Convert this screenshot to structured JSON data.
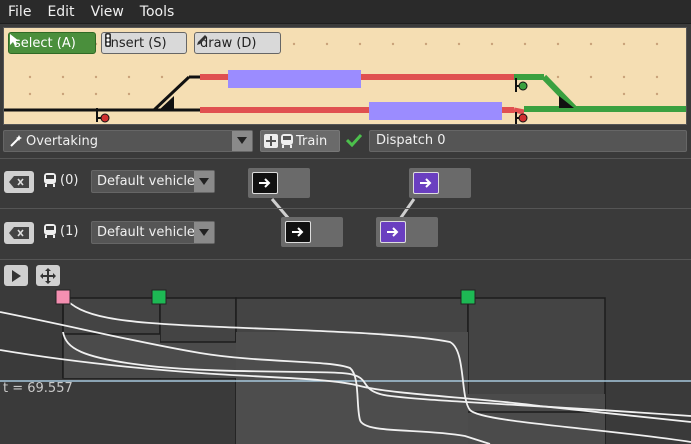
{
  "menubar": {
    "items": [
      "File",
      "Edit",
      "View",
      "Tools"
    ]
  },
  "toolbar": {
    "select_label": "select (A)",
    "insert_label": "insert (S)",
    "draw_label": "draw (D)"
  },
  "scenario": {
    "selected": "Overtaking",
    "add_train_label": "Train",
    "dispatch_label": "Dispatch 0"
  },
  "vehicles": [
    {
      "index_label": "(0)",
      "vehicle": "Default vehicle"
    },
    {
      "index_label": "(1)",
      "vehicle": "Default vehicle"
    }
  ],
  "graph": {
    "time_label": "t = 69.557"
  },
  "colors": {
    "canvas_bg": "#f5deb3",
    "track": "#111111",
    "track_red": "#e05050",
    "track_green": "#3aa040",
    "train": "#9b8cff",
    "active_tool": "#4a8f3c",
    "purple_arrow": "#6a3fc0",
    "graph_line": "#f0f0f0",
    "time_line": "#a6c8dc",
    "marker_pink": "#f48fb1",
    "marker_green": "#1db954"
  },
  "icons": {
    "select": "cursor-arrow-icon",
    "insert": "traffic-light-icon",
    "draw": "pencil-icon",
    "scenario": "magic-wand-icon",
    "add": "plus-icon",
    "train": "train-icon",
    "check": "check-icon",
    "delete": "backspace-icon",
    "play": "play-icon",
    "move": "move-arrows-icon",
    "route": "arrow-right-icon"
  }
}
